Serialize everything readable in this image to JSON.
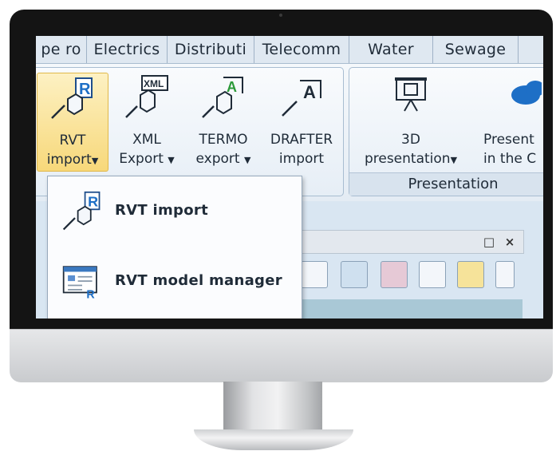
{
  "tabs": [
    "pe ro",
    "Electrics",
    "Distributi",
    "Telecomm",
    "Water",
    "Sewage"
  ],
  "ribbon": {
    "buttons": [
      {
        "line1": "RVT",
        "line2": "import",
        "has_caret": true,
        "icon": "rvt-import-icon"
      },
      {
        "line1": "XML",
        "line2": "Export",
        "has_caret": true,
        "icon": "xml-export-icon",
        "icon_label": "XML"
      },
      {
        "line1": "TERMO",
        "line2": "export",
        "has_caret": true,
        "icon": "termo-export-icon",
        "icon_label": "A"
      },
      {
        "line1": "DRAFTER",
        "line2": "import",
        "has_caret": false,
        "icon": "drafter-import-icon",
        "icon_label": "A"
      },
      {
        "line1": "3D",
        "line2": "presentation",
        "has_caret": true,
        "icon": "presentation-3d-icon"
      },
      {
        "line1": "Present",
        "line2": "in the C",
        "has_caret": false,
        "icon": "cloud-icon"
      }
    ],
    "group_label": "Presentation"
  },
  "dropdown": {
    "items": [
      {
        "label": "RVT import",
        "icon": "rvt-import-icon"
      },
      {
        "label": "RVT model manager",
        "icon": "rvt-model-manager-icon"
      }
    ]
  },
  "panel": {
    "restore": "□",
    "close": "×"
  },
  "colors": {
    "accent": "#1e6fc6",
    "active": "#f7d87a",
    "ribbon": "#e4ecf4"
  }
}
